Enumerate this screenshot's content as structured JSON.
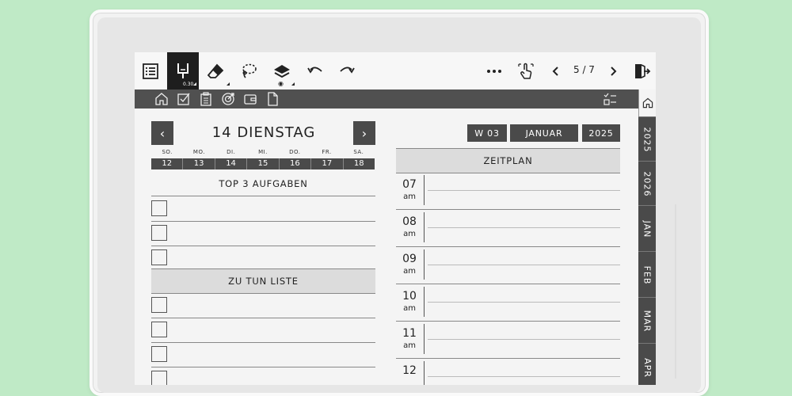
{
  "toolbar": {
    "pen_size": "0.30",
    "page_indicator": "5 / 7",
    "icons": [
      "toc-icon",
      "pen-icon",
      "eraser-icon",
      "lasso-icon",
      "layers-icon",
      "undo-icon",
      "redo-icon",
      "more-icon",
      "touch-icon",
      "prev-page-icon",
      "next-page-icon",
      "exit-icon"
    ]
  },
  "tabbar": {
    "icons": [
      "home-icon",
      "checkbox-icon",
      "clipboard-icon",
      "target-icon",
      "wallet-icon",
      "document-icon",
      "checklist-icon"
    ]
  },
  "sidebar": {
    "tabs": [
      "2025",
      "2026",
      "JAN",
      "FEB",
      "MAR",
      "APR"
    ]
  },
  "day": {
    "title": "14 DIENSTAG",
    "prev": "‹",
    "next": "›",
    "weekdays": [
      "SO.",
      "MO.",
      "DI.",
      "MI.",
      "DO.",
      "FR.",
      "SA."
    ],
    "dates": [
      "12",
      "13",
      "14",
      "15",
      "16",
      "17",
      "18"
    ]
  },
  "left": {
    "top3_title": "TOP 3 AUFGABEN",
    "todo_title": "ZU TUN LISTE"
  },
  "right": {
    "week": "W 03",
    "month": "JANUAR",
    "year": "2025",
    "schedule_title": "ZEITPLAN",
    "hours": [
      {
        "h": "07",
        "ampm": "am"
      },
      {
        "h": "08",
        "ampm": "am"
      },
      {
        "h": "09",
        "ampm": "am"
      },
      {
        "h": "10",
        "ampm": "am"
      },
      {
        "h": "11",
        "ampm": "am"
      },
      {
        "h": "12",
        "ampm": ""
      }
    ]
  }
}
